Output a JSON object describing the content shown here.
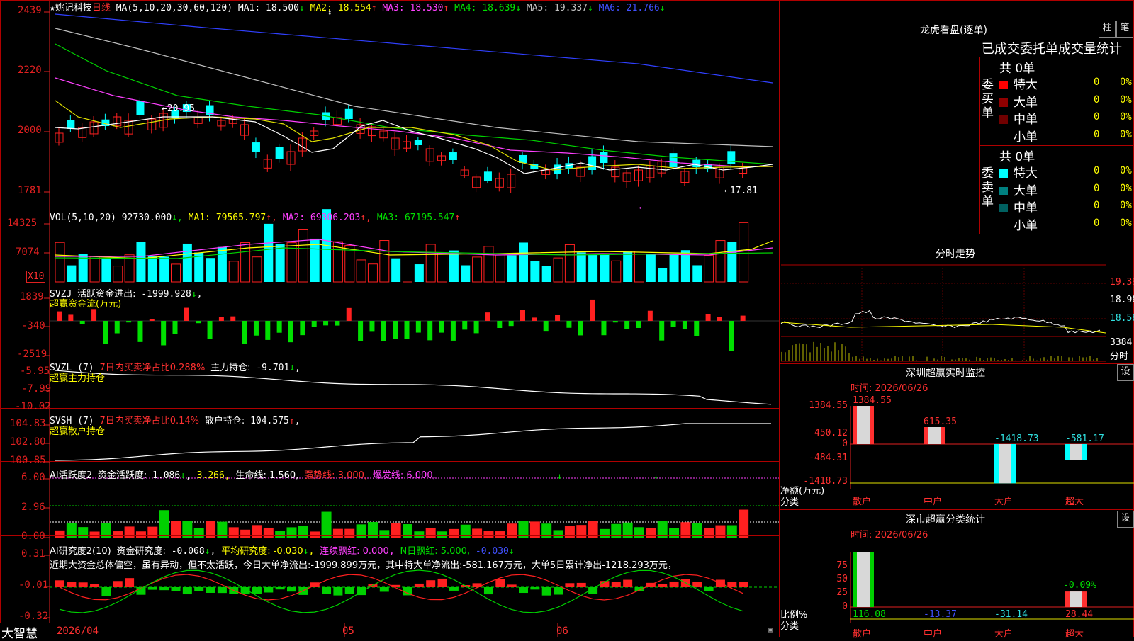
{
  "stock": {
    "star": "★",
    "name": "姚记科技",
    "period": "日线"
  },
  "ma_header": {
    "label": "MA(5,10,20,30,60,120)",
    "items": [
      {
        "text": "MA1: 18.500",
        "arrow": "↓",
        "color": "#ffffff"
      },
      {
        "text": "MA2: 18.554",
        "arrow": "↑",
        "color": "#ffff00"
      },
      {
        "text": "MA3: 18.530",
        "arrow": "↑",
        "color": "#ff40ff"
      },
      {
        "text": "MA4: 18.639",
        "arrow": "↓",
        "color": "#00e000"
      },
      {
        "text": "MA5: 19.337",
        "arrow": "↓",
        "color": "#c0c0c0"
      },
      {
        "text": "MA6: 21.766",
        "arrow": "↓",
        "color": "#4050ff"
      }
    ]
  },
  "price_axis": [
    "2439",
    "2220",
    "2000",
    "1781"
  ],
  "price_annotations": {
    "high": "←20.95",
    "low": "←17.81"
  },
  "vol": {
    "label": "VOL(5,10,20)",
    "value": "92730.000",
    "ma1": "MA1: 79565.797",
    "ma2": "MA2: 69306.203",
    "ma3": "MA3: 67195.547",
    "axis": [
      "14325",
      "7074"
    ],
    "unit": "X10"
  },
  "svzj": {
    "label": "SVZJ",
    "title": "活跃资金进出:",
    "value": "-1999.928",
    "sub": "超赢资金流(万元)",
    "axis": [
      "1839",
      "-340",
      "-2519"
    ]
  },
  "svzl": {
    "label": "SVZL (7)",
    "desc": "7日内买卖净占比0.288%",
    "title": "主力持仓:",
    "value": "-9.701",
    "sub": "超赢主力持仓",
    "axis": [
      "-5.95",
      "-7.99",
      "-10.02"
    ]
  },
  "svsh": {
    "label": "SVSH (7)",
    "desc": "7日内买卖净占比0.14%",
    "title": "散户持仓:",
    "value": "104.575",
    "sub": "超赢散户持仓",
    "axis": [
      "104.83",
      "102.80",
      "100.85"
    ]
  },
  "ai_active": {
    "label": "AI活跃度2",
    "title": "资金活跃度:",
    "value": "1.086",
    "v2": "3.266",
    "life": "生命线: 1.560,",
    "strong": "强势线: 3.000,",
    "burst": "爆发线: 6.000,",
    "axis": [
      "6.00",
      "2.96",
      "0.00"
    ]
  },
  "ai_research": {
    "label": "AI研究度2(10)",
    "title": "资金研究度:",
    "value": "-0.068",
    "avg": "平均研究度: -0.030",
    "red": "连续飘红: 0.000",
    "nred": "N日飘红: 5.000,",
    "nval": "-0.030",
    "comment": "近期大资金总体偏空，虽有异动，但不太活跃，今日大单净流出:-1999.899万元，其中特大单净流出:-581.167万元，大单5日累计净出-1218.293万元，",
    "axis": [
      "0.31",
      "-0.01",
      "-0.32"
    ]
  },
  "time_axis": {
    "logo": "大智慧",
    "d1": "2026/04",
    "d2": "05",
    "d3": "06"
  },
  "right": {
    "title": "龙虎看盘(逐单)",
    "btn1": "柱",
    "btn2": "笔",
    "stats_title": "已成交委托单成交量统计",
    "buy": {
      "label": "委买单",
      "total": "共 0单",
      "rows": [
        {
          "name": "特大",
          "n": "0",
          "pct": "0%",
          "color": "#ff0000"
        },
        {
          "name": "大单",
          "n": "0",
          "pct": "0%",
          "color": "#900000"
        },
        {
          "name": "中单",
          "n": "0",
          "pct": "0%",
          "color": "#700000"
        },
        {
          "name": "小单",
          "n": "0",
          "pct": "0%",
          "color": "#000000"
        }
      ]
    },
    "sell": {
      "label": "委卖单",
      "total": "共 0单",
      "rows": [
        {
          "name": "特大",
          "n": "0",
          "pct": "0%",
          "color": "#00ffff"
        },
        {
          "name": "大单",
          "n": "0",
          "pct": "0%",
          "color": "#008080"
        },
        {
          "name": "中单",
          "n": "0",
          "pct": "0%",
          "color": "#006060"
        },
        {
          "name": "小单",
          "n": "0",
          "pct": "0%",
          "color": "#000000"
        }
      ]
    },
    "intraday": {
      "title": "分时走势",
      "p1": "19.39",
      "p2": "18.98",
      "p3": "18.58",
      "vol": "3384",
      "unit": "分时"
    },
    "monitor": {
      "title": "深圳超赢实时监控",
      "set": "设",
      "time": "时间: 2026/06/26",
      "axis": [
        "1384.55",
        "450.12",
        "0",
        "-484.31",
        "-1418.73"
      ],
      "bars": [
        {
          "cat": "散户",
          "value": 1384.55,
          "label": "1384.55"
        },
        {
          "cat": "中户",
          "value": 615.35,
          "label": "615.35"
        },
        {
          "cat": "大户",
          "value": -1418.73,
          "label": "-1418.73"
        },
        {
          "cat": "超大",
          "value": -581.17,
          "label": "-581.17"
        }
      ],
      "ylabel": "净额(万元)",
      "xlabel": "分类"
    },
    "classify": {
      "title": "深市超赢分类统计",
      "set": "设",
      "time": "时间: 2026/06/26",
      "axis": [
        "75",
        "50",
        "25",
        "0"
      ],
      "pct_label": "-0.09%",
      "bars": [
        {
          "cat": "散户",
          "value": 116.08,
          "label": "116.08"
        },
        {
          "cat": "中户",
          "value": -13.37,
          "label": "-13.37"
        },
        {
          "cat": "大户",
          "value": -31.14,
          "label": "-31.14"
        },
        {
          "cat": "超大",
          "value": 28.44,
          "label": "28.44"
        }
      ],
      "ylabel": "比例%",
      "xlabel": "分类"
    }
  }
}
